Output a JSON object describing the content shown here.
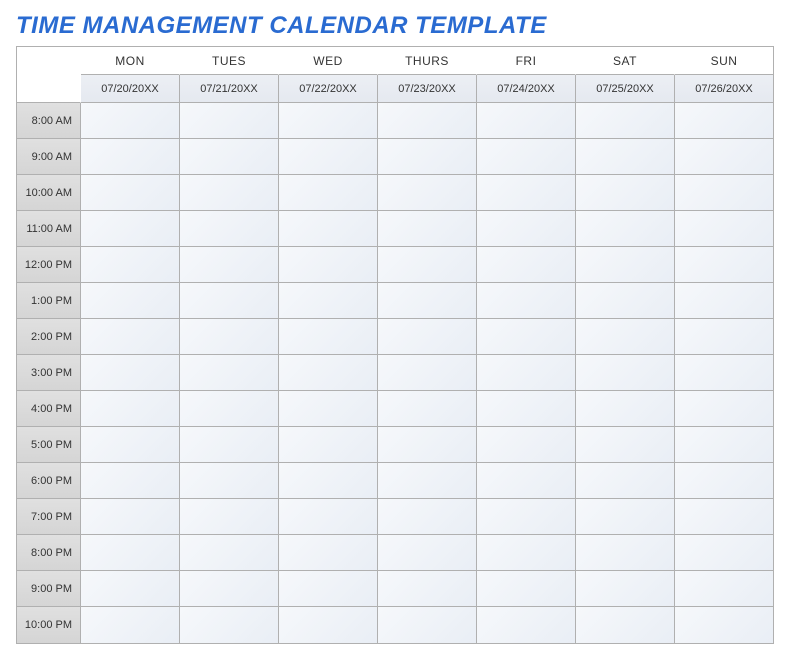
{
  "title": "TIME MANAGEMENT CALENDAR TEMPLATE",
  "days": [
    {
      "name": "MON",
      "date": "07/20/20XX"
    },
    {
      "name": "TUES",
      "date": "07/21/20XX"
    },
    {
      "name": "WED",
      "date": "07/22/20XX"
    },
    {
      "name": "THURS",
      "date": "07/23/20XX"
    },
    {
      "name": "FRI",
      "date": "07/24/20XX"
    },
    {
      "name": "SAT",
      "date": "07/25/20XX"
    },
    {
      "name": "SUN",
      "date": "07/26/20XX"
    }
  ],
  "times": [
    "8:00 AM",
    "9:00 AM",
    "10:00 AM",
    "11:00 AM",
    "12:00 PM",
    "1:00 PM",
    "2:00 PM",
    "3:00 PM",
    "4:00 PM",
    "5:00 PM",
    "6:00 PM",
    "7:00 PM",
    "8:00 PM",
    "9:00 PM",
    "10:00 PM"
  ]
}
